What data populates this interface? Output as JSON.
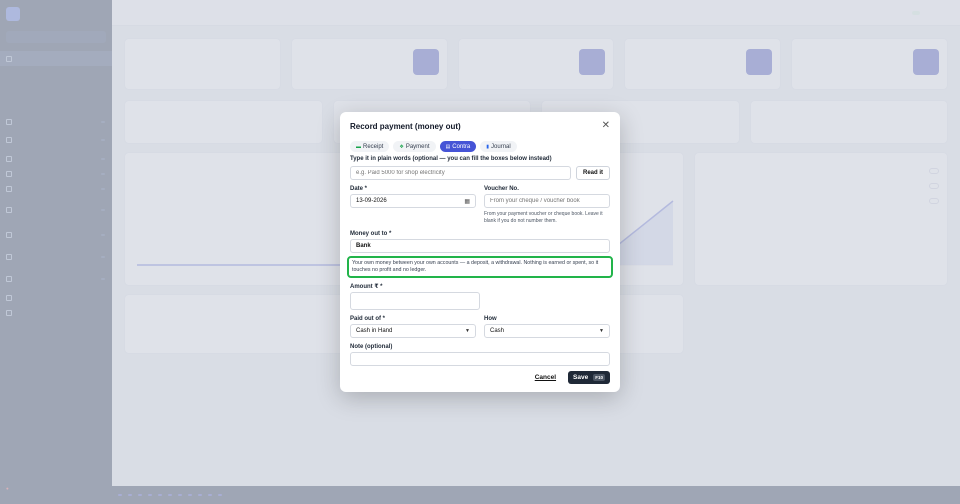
{
  "modal": {
    "title": "Record payment (money out)",
    "tabs": [
      {
        "label": "Receipt",
        "icon": "cash-icon",
        "active": false
      },
      {
        "label": "Payment",
        "icon": "payment-icon",
        "active": false
      },
      {
        "label": "Contra",
        "icon": "contra-icon",
        "active": true
      },
      {
        "label": "Journal",
        "icon": "journal-icon",
        "active": false
      }
    ],
    "plain_words": {
      "label": "Type it in plain words (optional — you can fill the boxes below instead)",
      "placeholder": "e.g. Paid 5000 for shop electricity",
      "button": "Read it"
    },
    "date": {
      "label": "Date *",
      "value": "13-09-2026"
    },
    "voucher": {
      "label": "Voucher No.",
      "placeholder": "From your cheque / voucher book",
      "help": "From your payment voucher or cheque book. Leave it blank if you do not number them."
    },
    "money_out": {
      "label": "Money out to *",
      "value": "Bank",
      "info": "Your own money between your own accounts — a deposit, a withdrawal. Nothing is earned or spent, so it touches no profit and no ledger."
    },
    "amount": {
      "label": "Amount ₹ *",
      "value": ""
    },
    "paid_out_of": {
      "label": "Paid out of *",
      "value": "Cash in Hand"
    },
    "how": {
      "label": "How",
      "value": "Cash"
    },
    "note": {
      "label": "Note (optional)",
      "value": ""
    },
    "cancel_label": "Cancel",
    "save_label": "Save",
    "save_key": "F10"
  }
}
